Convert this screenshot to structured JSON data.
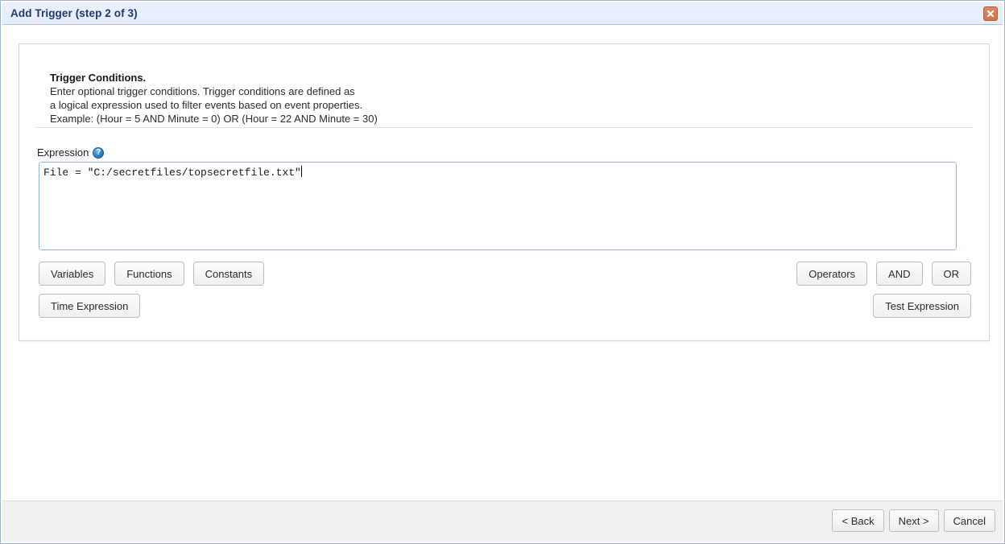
{
  "window": {
    "title": "Add Trigger (step 2 of 3)",
    "close_icon": "close-icon"
  },
  "panel": {
    "heading": "Trigger Conditions.",
    "description_lines": [
      "Enter optional trigger conditions. Trigger conditions are defined as",
      "a logical expression used to filter events based on event properties.",
      "Example: (Hour = 5 AND Minute = 0) OR (Hour = 22 AND Minute = 30)"
    ],
    "expression": {
      "label": "Expression",
      "help_icon": "help-icon",
      "help_glyph": "?",
      "value": "File = \"C:/secretfiles/topsecretfile.txt\"",
      "placeholder": ""
    },
    "toolbar": {
      "left_row_1": [
        {
          "label": "Variables"
        },
        {
          "label": "Functions"
        },
        {
          "label": "Constants"
        }
      ],
      "left_row_2": [
        {
          "label": "Time Expression"
        }
      ],
      "right_row_1": [
        {
          "label": "Operators"
        },
        {
          "label": "AND"
        },
        {
          "label": "OR"
        }
      ],
      "right_row_2": [
        {
          "label": "Test Expression"
        }
      ]
    }
  },
  "footer": {
    "back_label": "< Back",
    "next_label": "Next >",
    "cancel_label": "Cancel"
  },
  "colors": {
    "titlebar_bg": "#eaf0fd",
    "titlebar_text": "#1d3a72",
    "window_border": "#9cb6e0",
    "close_button": "#d2744b",
    "focus_border": "#8fb4e8",
    "help_icon": "#2e80cc",
    "footer_bg": "#f1f1f1"
  }
}
